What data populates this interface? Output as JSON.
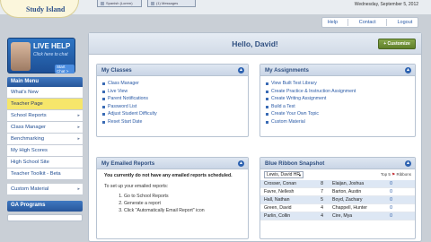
{
  "app": {
    "logo_text": "Study Island"
  },
  "top_tabs": [
    {
      "label": "Spanish (Lorem)"
    },
    {
      "label": "(1) Messages"
    }
  ],
  "date": "Wednesday, September 5, 2012",
  "top_nav": [
    {
      "label": "Help"
    },
    {
      "label": "Contact"
    },
    {
      "label": "Logout"
    }
  ],
  "live_help": {
    "title": "LIVE HELP",
    "subtitle": "Click here to chat",
    "button": "Start Chat >"
  },
  "sidebar": {
    "header": "Main Menu",
    "items": [
      {
        "label": "What's New"
      },
      {
        "label": "Teacher Page"
      },
      {
        "label": "School Reports"
      },
      {
        "label": "Class Manager"
      },
      {
        "label": "Benchmarking"
      },
      {
        "label": "My High Scores"
      },
      {
        "label": "High School Site"
      },
      {
        "label": "Teacher Toolkit - Beta"
      },
      {
        "label": "Custom Material"
      }
    ],
    "bottom": "GA Programs"
  },
  "main": {
    "greeting": "Hello, David!",
    "customize_label": "+ Customize",
    "my_classes": {
      "title": "My Classes",
      "items": [
        "Class Manager",
        "Live View",
        "Parent Notifications",
        "Password List",
        "Adjust Student Difficulty",
        "Reset Start Date"
      ]
    },
    "my_assignments": {
      "title": "My Assignments",
      "items": [
        "View Built Test Library",
        "Create Practice & Instruction Assignment",
        "Create Writing Assignment",
        "Build a Test",
        "Create Your Own Topic",
        "Custom Material"
      ]
    },
    "emailed_reports": {
      "title": "My Emailed Reports",
      "empty_text": "You currently do not have any emailed reports scheduled.",
      "setup_label": "To set up your emailed reports:",
      "steps": [
        "Go to School Reports",
        "Generate a report",
        "Click \"Automatically Email Report\" icon"
      ]
    },
    "blue_ribbon": {
      "title": "Blue Ribbon Snapshot",
      "selected_class": "Lewis, David HR",
      "top_label": "Top 5",
      "top_sub": "Ribbons",
      "rows": [
        {
          "n1": "Crosser, Conan",
          "s1": "8",
          "n2": "Elaijan, Joshua",
          "s2": "0"
        },
        {
          "n1": "Favre, Nellesh",
          "s1": "7",
          "n2": "Barton, Austin",
          "s2": "0"
        },
        {
          "n1": "Hall, Nathan",
          "s1": "5",
          "n2": "Boyd, Zachary",
          "s2": "0"
        },
        {
          "n1": "Green, David",
          "s1": "4",
          "n2": "Chappell, Hunter",
          "s2": "0"
        },
        {
          "n1": "Parlin, Collin",
          "s1": "4",
          "n2": "Cire, Mya",
          "s2": "0"
        }
      ]
    }
  }
}
